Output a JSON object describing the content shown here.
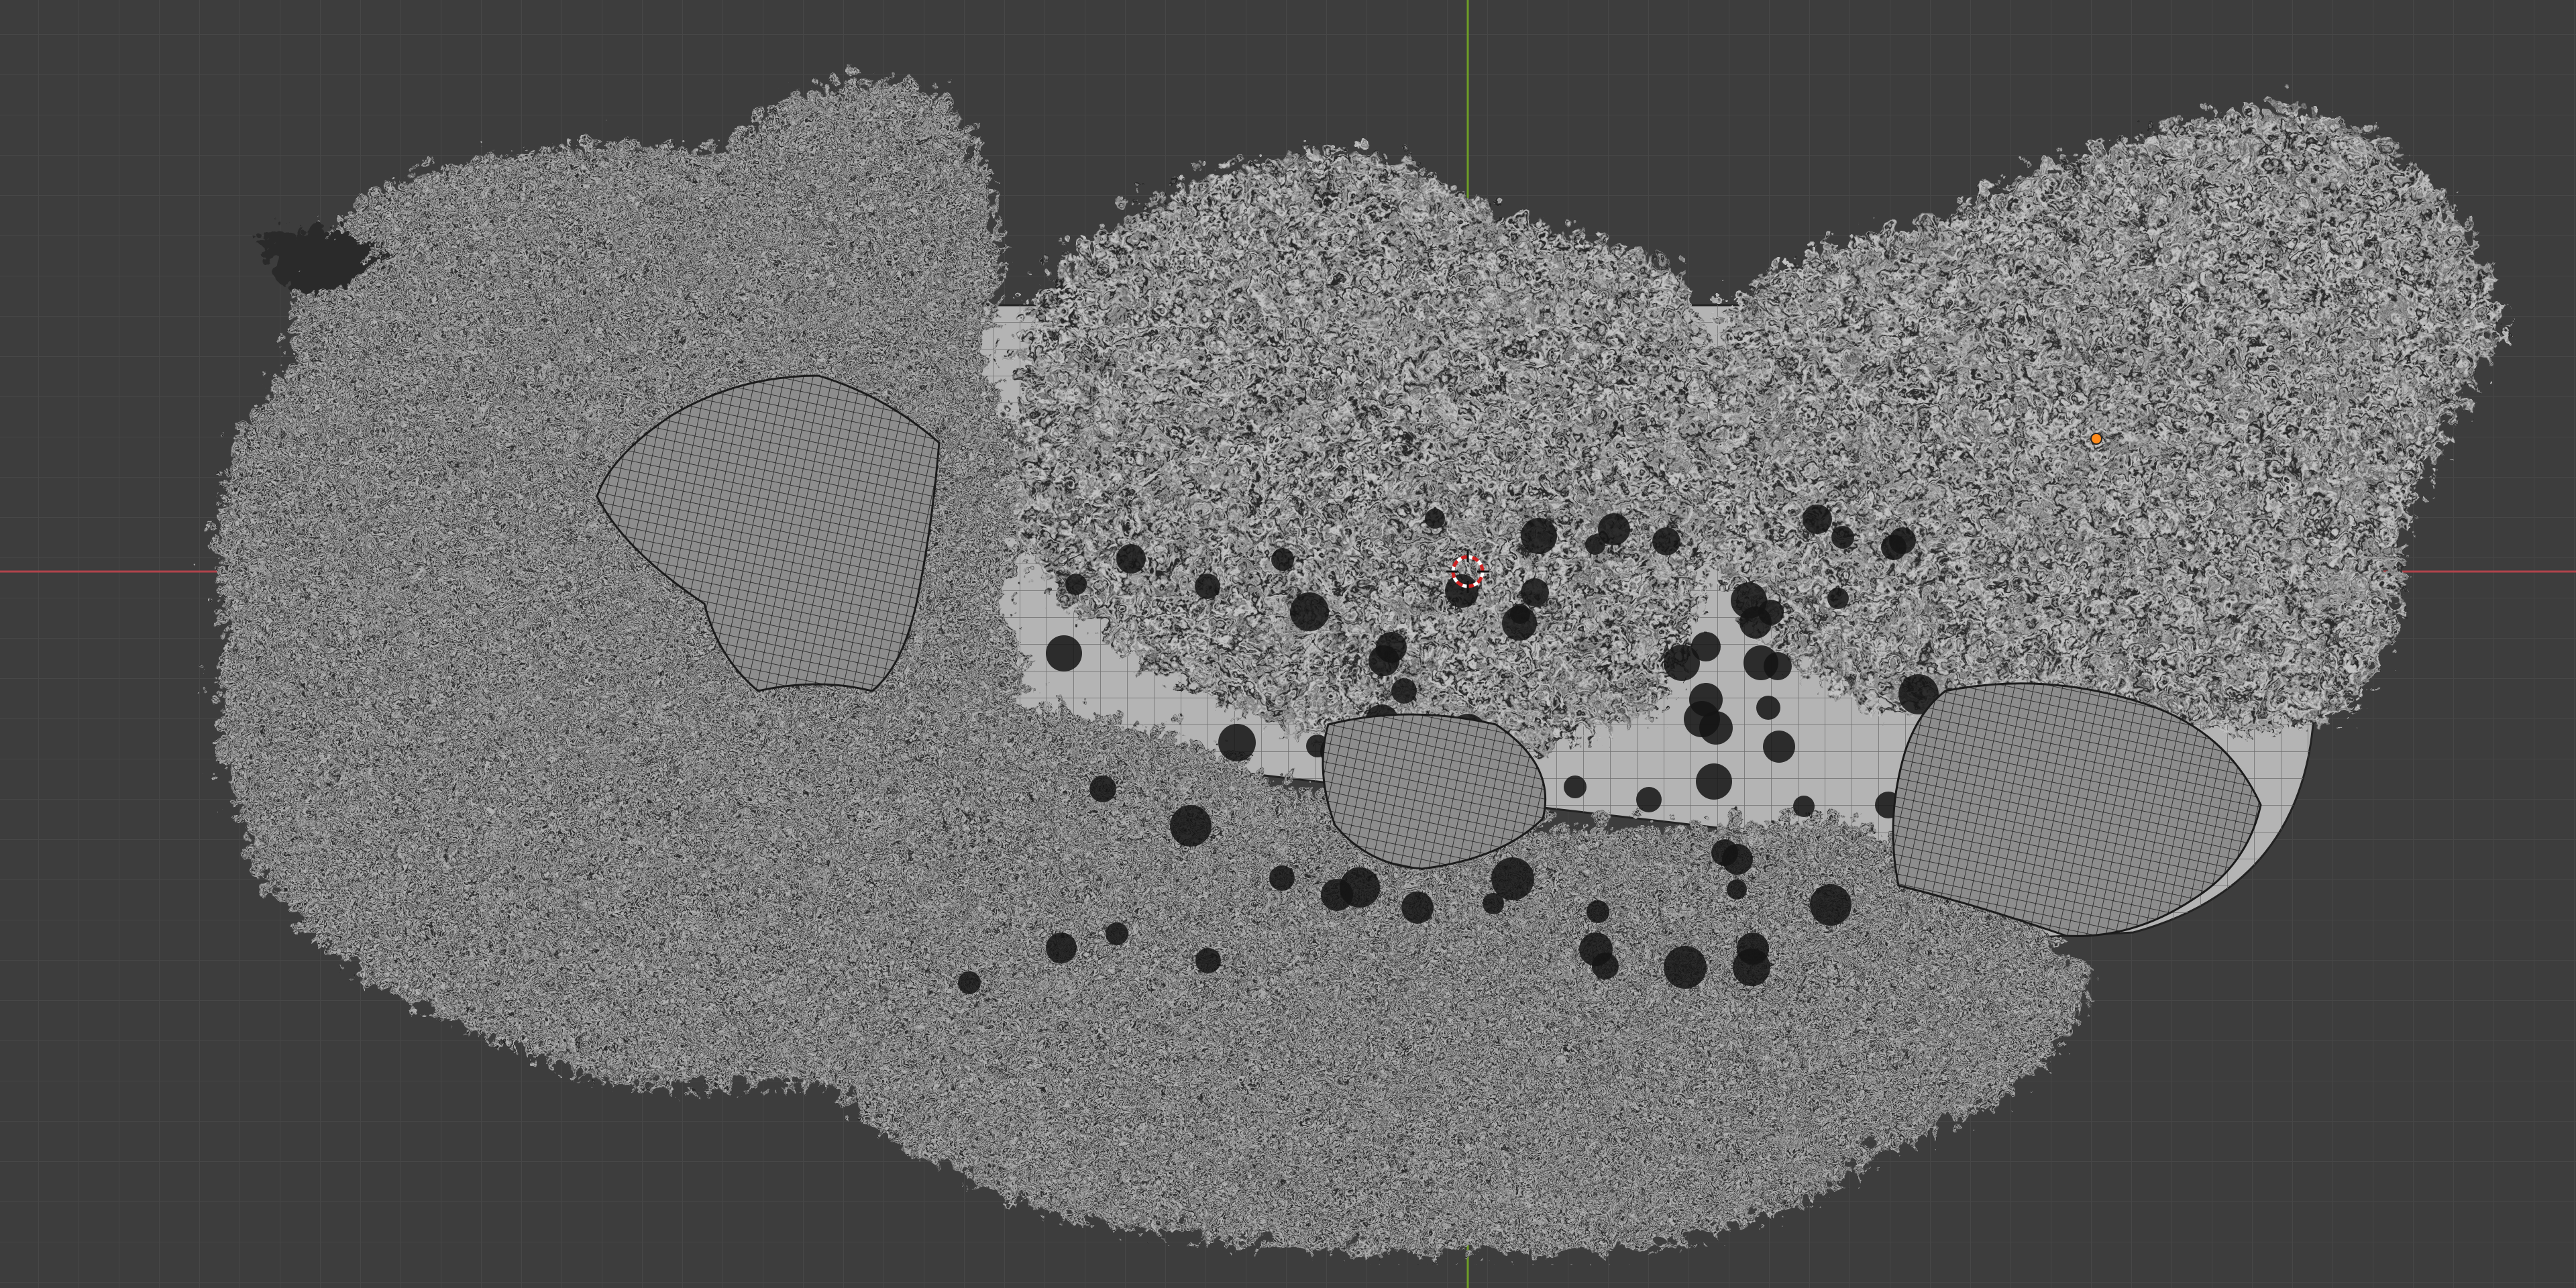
{
  "viewport": {
    "mode": "3d-viewport-top-orthographic-wireframe",
    "background_color": "#3d3d3d",
    "grid_minor_color": "#474747",
    "grid_major_color": "#505050",
    "x_axis_color": "#b0444b",
    "y_axis_color": "#6e9e26",
    "wire_color": "#0a0a0a",
    "foliage_light_color": "#7a7a7a",
    "foliage_dark_color": "#1b1b1b",
    "rock_color": "#8a8a8a",
    "base_color": "#b4b4b4",
    "cursor_color": "#d02020",
    "origin_color": "#ff8a1a"
  },
  "scene_objects": [
    {
      "name": "foliage-cluster-left",
      "kind": "small-leaf-shrub"
    },
    {
      "name": "foliage-cluster-center",
      "kind": "fern-shrub"
    },
    {
      "name": "foliage-cluster-right",
      "kind": "fern-shrub"
    },
    {
      "name": "foliage-cluster-bottom",
      "kind": "small-leaf-shrub"
    },
    {
      "name": "rock-left",
      "kind": "rock"
    },
    {
      "name": "rock-center",
      "kind": "rock"
    },
    {
      "name": "rock-right",
      "kind": "rock"
    },
    {
      "name": "planter-base",
      "kind": "base-mesh"
    }
  ]
}
